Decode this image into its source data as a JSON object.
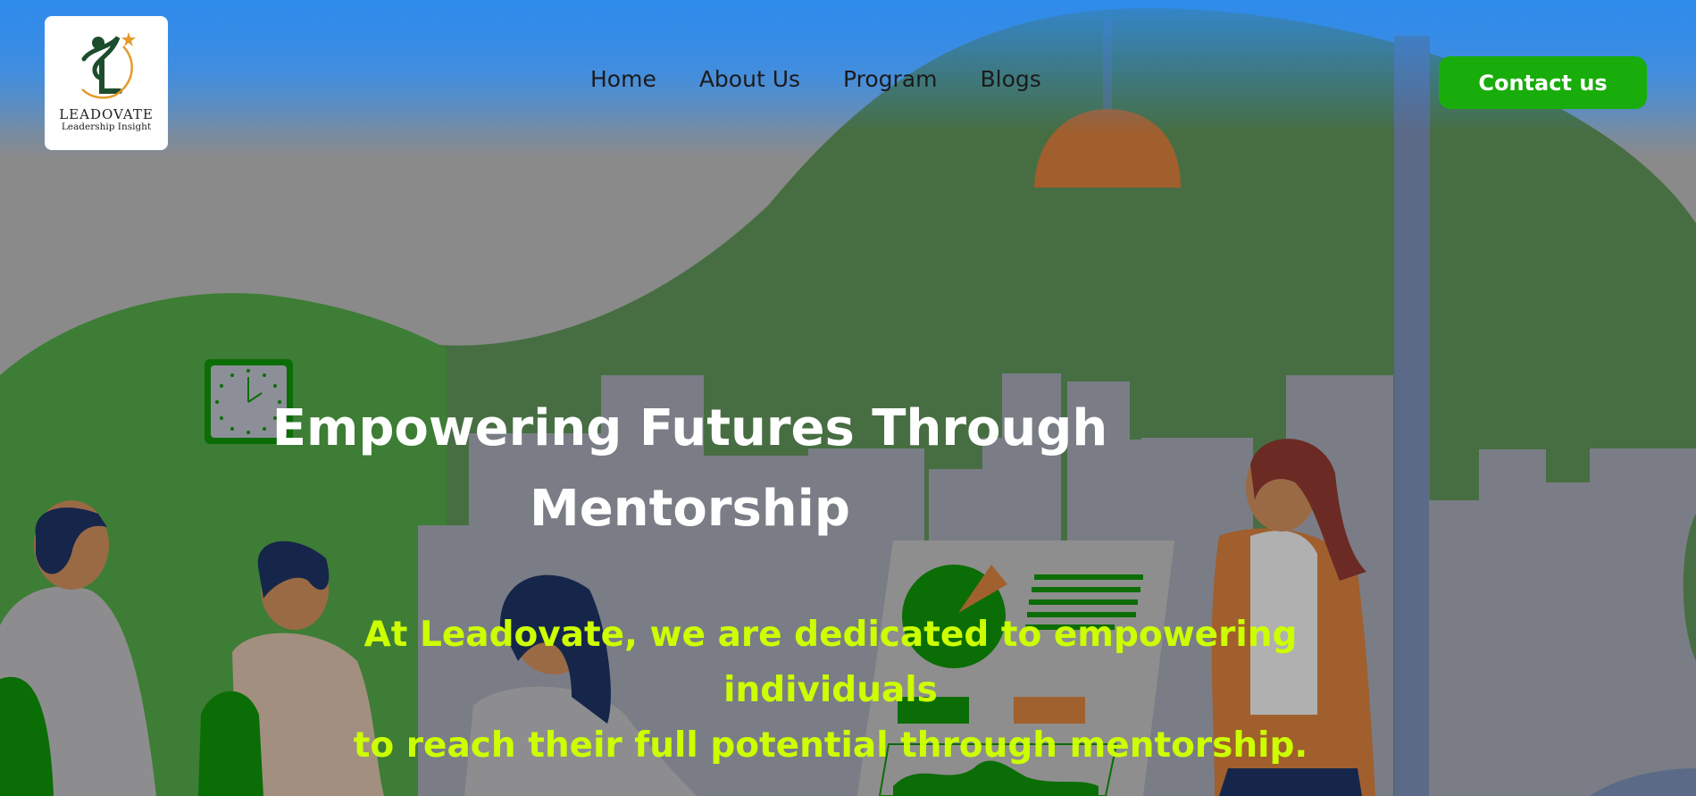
{
  "brand": {
    "name": "LEADOVATE",
    "tagline": "Leadership Insight",
    "logo_icon": "leader-figure-logo-icon"
  },
  "nav": {
    "items": [
      {
        "label": "Home"
      },
      {
        "label": "About Us"
      },
      {
        "label": "Program"
      },
      {
        "label": "Blogs"
      }
    ]
  },
  "header": {
    "contact_label": "Contact us"
  },
  "hero": {
    "title_line1": "Empowering Futures Through",
    "title_line2": "Mentorship",
    "subtitle_line1": "At Leadovate, we are dedicated to empowering individuals",
    "subtitle_line2": "to reach their full potential through mentorship."
  },
  "colors": {
    "sky_blue": "#2f8bea",
    "accent_green": "#18ad0a",
    "hill_green": "#476e42",
    "subtitle_lime": "#ccff00",
    "building_gray": "#7a7d86"
  }
}
